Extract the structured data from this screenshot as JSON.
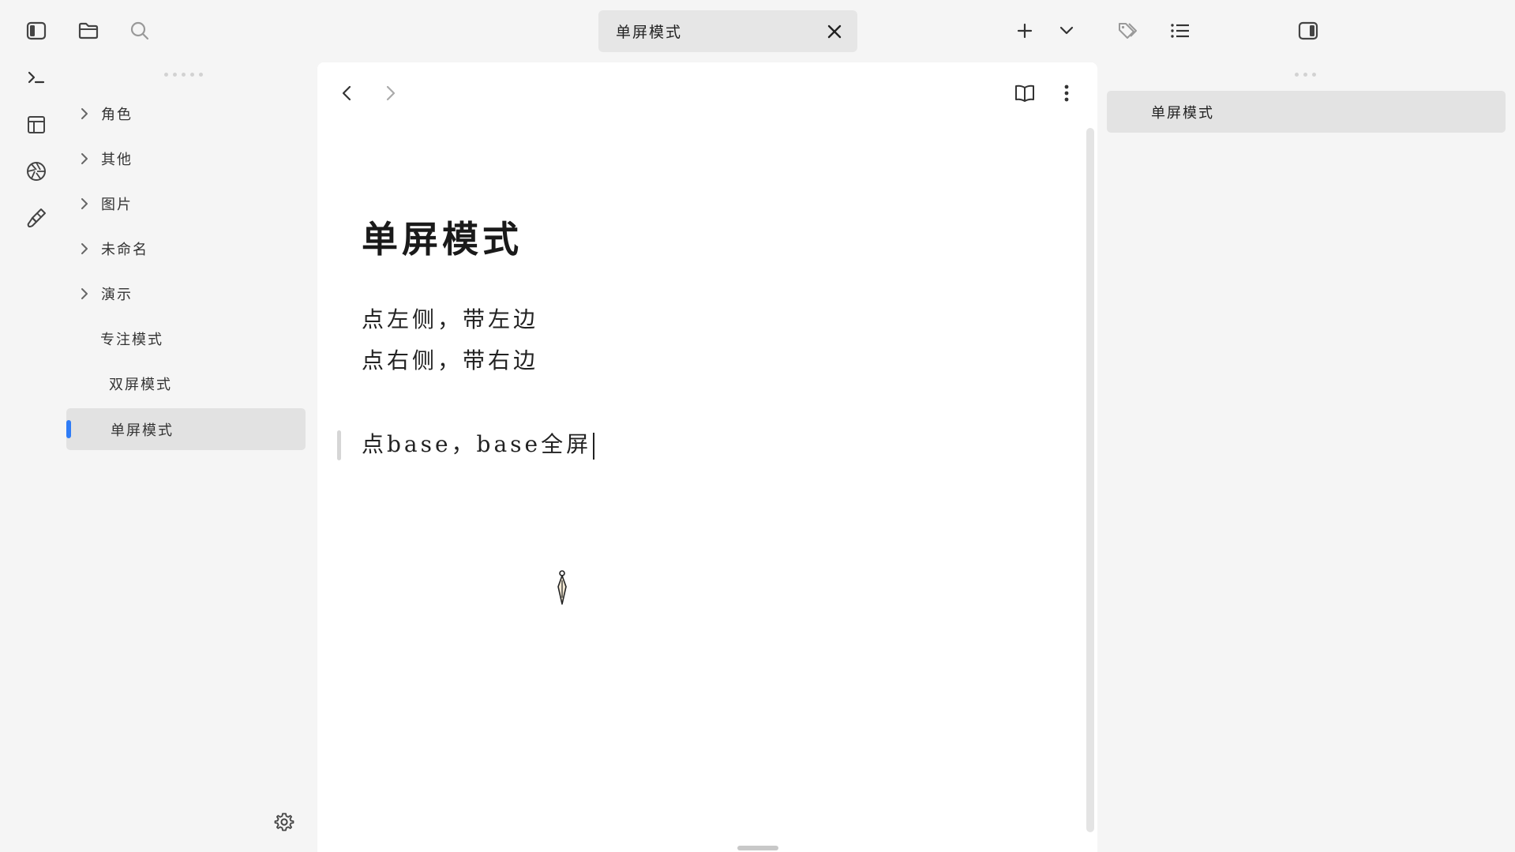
{
  "window": {
    "active_tab": {
      "title": "单屏模式"
    }
  },
  "toolbar": {
    "icons": [
      "sidebar-left-toggle-icon",
      "folder-icon",
      "search-icon",
      "plus-icon",
      "chevron-down-icon",
      "tag-icon",
      "list-icon",
      "sidebar-right-toggle-icon"
    ]
  },
  "ribbon": {
    "icons": [
      "terminal-icon",
      "layout-icon",
      "aperture-icon",
      "paintbrush-icon"
    ]
  },
  "file_tree": {
    "items": [
      {
        "label": "角色",
        "type": "folder"
      },
      {
        "label": "其他",
        "type": "folder"
      },
      {
        "label": "图片",
        "type": "folder"
      },
      {
        "label": "未命名",
        "type": "folder"
      },
      {
        "label": "演示",
        "type": "folder"
      },
      {
        "label": "专注模式",
        "type": "file"
      },
      {
        "label": "双屏模式",
        "type": "file"
      },
      {
        "label": "单屏模式",
        "type": "file",
        "active": true
      }
    ]
  },
  "editor": {
    "title": "单屏模式",
    "lines": [
      "点左侧，带左边",
      "点右侧，带右边",
      "点base，base全屏"
    ]
  },
  "outline": {
    "items": [
      "单屏模式"
    ]
  },
  "colors": {
    "accent": "#2f7cf6",
    "background": "#f5f5f5",
    "editor_background": "#ffffff",
    "active_item_background": "#e2e2e2"
  }
}
